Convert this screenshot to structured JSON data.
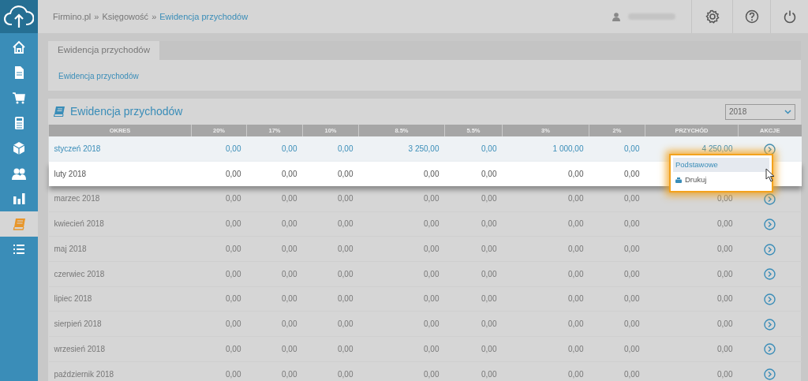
{
  "sidebar": {
    "items": [
      {
        "kind": "home",
        "selected": false
      },
      {
        "kind": "document",
        "selected": false
      },
      {
        "kind": "cart",
        "selected": false
      },
      {
        "kind": "calculator",
        "selected": false
      },
      {
        "kind": "box",
        "selected": false
      },
      {
        "kind": "users",
        "selected": false
      },
      {
        "kind": "chart",
        "selected": false
      },
      {
        "kind": "book",
        "selected": true
      },
      {
        "kind": "list",
        "selected": false
      }
    ]
  },
  "header": {
    "breadcrumb": [
      {
        "text": "Firmino.pl",
        "current": false,
        "separator": "»"
      },
      {
        "text": "Księgowość",
        "current": false,
        "separator": "»"
      },
      {
        "text": "Ewidencja przychodów",
        "current": true
      }
    ],
    "buttons": [
      {
        "kind": "settings"
      },
      {
        "kind": "help"
      },
      {
        "kind": "power"
      }
    ]
  },
  "tabs": [
    {
      "label": "Ewidencja przychodów",
      "selected": true
    }
  ],
  "tab_link": "Ewidencja przychodów",
  "panel": {
    "title": "Ewidencja przychodów",
    "year_select": "2018"
  },
  "table": {
    "columns": [
      "OKRES",
      "20%",
      "17%",
      "10%",
      "8.5%",
      "5.5%",
      "3%",
      "2%",
      "PRZYCHÓD",
      "AKCJE"
    ],
    "rows": [
      {
        "period": "styczeń 2018",
        "values": [
          "0,00",
          "0,00",
          "0,00",
          "3 250,00",
          "0,00",
          "1 000,00",
          "0,00",
          "4 250,00"
        ],
        "selected": true,
        "spotlight": true,
        "actions_open": true
      },
      {
        "period": "luty 2018",
        "values": [
          "0,00",
          "0,00",
          "0,00",
          "0,00",
          "0,00",
          "0,00",
          "0,00"
        ],
        "selected": false,
        "spotlight": true
      },
      {
        "period": "marzec 2018",
        "values": [
          "0,00",
          "0,00",
          "0,00",
          "0,00",
          "0,00",
          "0,00",
          "0,00",
          "0,00"
        ],
        "selected": false,
        "spotlight": false
      },
      {
        "period": "kwiecień 2018",
        "values": [
          "0,00",
          "0,00",
          "0,00",
          "0,00",
          "0,00",
          "0,00",
          "0,00",
          "0,00"
        ],
        "selected": false,
        "spotlight": false
      },
      {
        "period": "maj 2018",
        "values": [
          "0,00",
          "0,00",
          "0,00",
          "0,00",
          "0,00",
          "0,00",
          "0,00",
          "0,00"
        ],
        "selected": false,
        "spotlight": false
      },
      {
        "period": "czerwiec 2018",
        "values": [
          "0,00",
          "0,00",
          "0,00",
          "0,00",
          "0,00",
          "0,00",
          "0,00",
          "0,00"
        ],
        "selected": false,
        "spotlight": false
      },
      {
        "period": "lipiec 2018",
        "values": [
          "0,00",
          "0,00",
          "0,00",
          "0,00",
          "0,00",
          "0,00",
          "0,00",
          "0,00"
        ],
        "selected": false,
        "spotlight": false
      },
      {
        "period": "sierpień 2018",
        "values": [
          "0,00",
          "0,00",
          "0,00",
          "0,00",
          "0,00",
          "0,00",
          "0,00",
          "0,00"
        ],
        "selected": false,
        "spotlight": false
      },
      {
        "period": "wrzesień 2018",
        "values": [
          "0,00",
          "0,00",
          "0,00",
          "0,00",
          "0,00",
          "0,00",
          "0,00",
          "0,00"
        ],
        "selected": false,
        "spotlight": false
      },
      {
        "period": "październik 2018",
        "values": [
          "0,00",
          "0,00",
          "0,00",
          "0,00",
          "0,00",
          "0,00",
          "0,00",
          "0,00"
        ],
        "selected": false,
        "spotlight": false
      }
    ]
  },
  "action_menu": {
    "header": "Podstawowe",
    "items": [
      {
        "label": "Drukuj"
      }
    ]
  }
}
